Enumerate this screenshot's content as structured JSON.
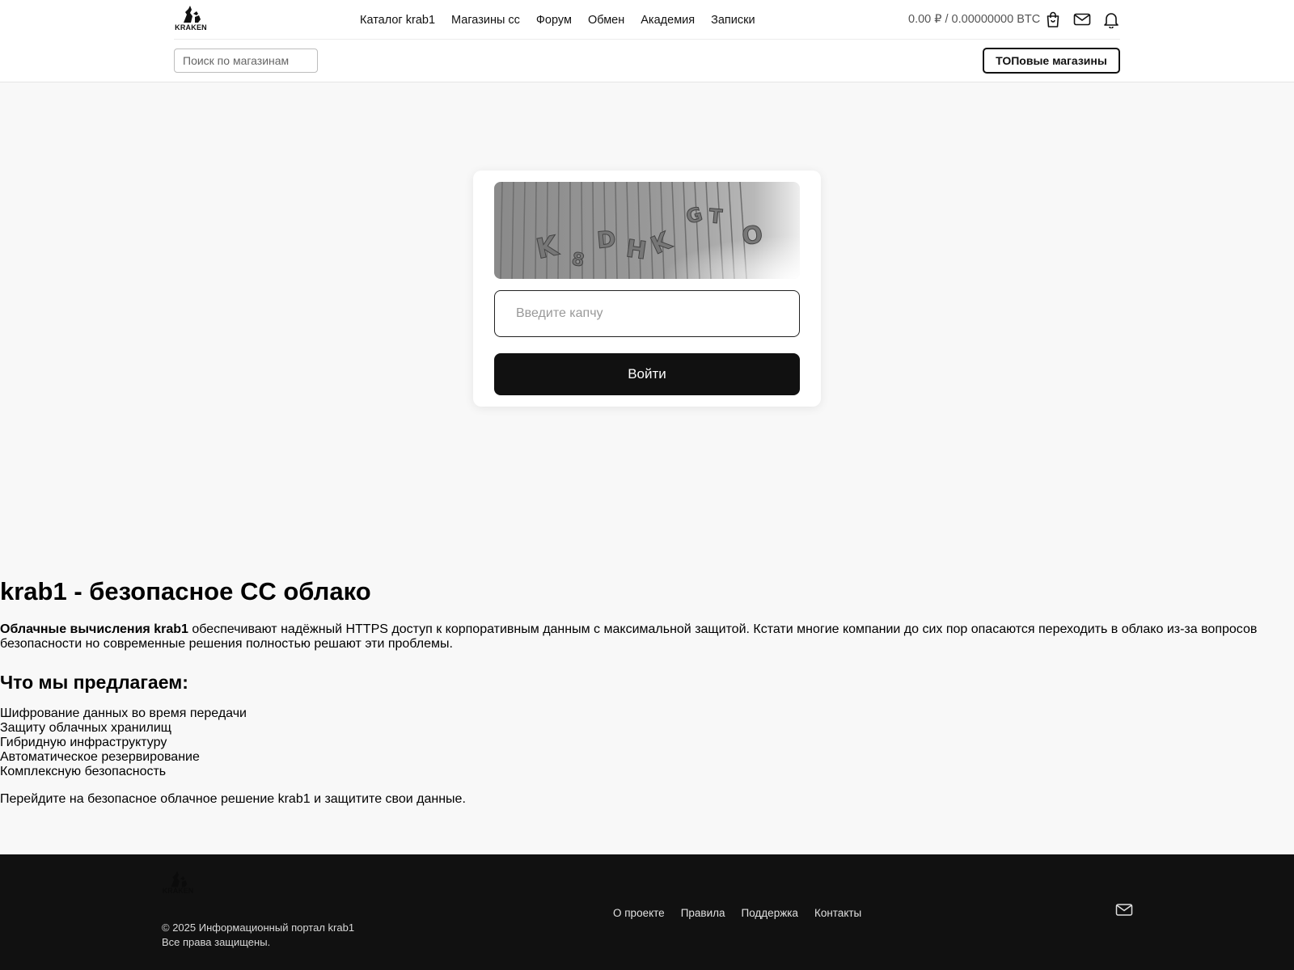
{
  "header": {
    "logo_text": "KRAKEN",
    "nav": [
      {
        "label": "Каталог krab1"
      },
      {
        "label": "Магазины сс"
      },
      {
        "label": "Форум"
      },
      {
        "label": "Обмен"
      },
      {
        "label": "Академия"
      },
      {
        "label": "Записки"
      }
    ],
    "balance": "0.00 ₽ / 0.00000000 BTC",
    "icons": [
      "bag-icon",
      "mail-icon",
      "bell-icon"
    ],
    "search_placeholder": "Поиск по магазинам",
    "top_shops_label": "ТОПовые магазины"
  },
  "captcha": {
    "image_text": "KEDHKGTO",
    "input_placeholder": "Введите капчу",
    "submit_label": "Войти"
  },
  "content": {
    "title": "krab1 - безопасное CC облако",
    "intro_bold": "Облачные вычисления krab1",
    "intro_rest": " обеспечивают надёжный HTTPS доступ к корпоративным данным с максимальной защитой. Кстати многие компании до сих пор опасаются переходить в облако из-за вопросов безопасности но современные решения полностью решают эти проблемы.",
    "offer_title": "Что мы предлагаем:",
    "offers": [
      "Шифрование данных во время передачи",
      "Защиту облачных хранилищ",
      "Гибридную инфраструктуру",
      "Автоматическое резервирование",
      "Комплексную безопасность"
    ],
    "outro": "Перейдите на безопасное облачное решение krab1 и защитите свои данные."
  },
  "footer": {
    "logo_text": "KRAKEN",
    "copyright": "© 2025 Информационный портал krab1",
    "rights": "Все права защищены.",
    "nav": [
      {
        "label": "О проекте"
      },
      {
        "label": "Правила"
      },
      {
        "label": "Поддержка"
      },
      {
        "label": "Контакты"
      }
    ],
    "icons": [
      "mail-icon"
    ]
  },
  "colors": {
    "background": "#f8f8f8",
    "header_bg": "#ffffff",
    "footer_bg": "#111111",
    "accent": "#111111"
  }
}
